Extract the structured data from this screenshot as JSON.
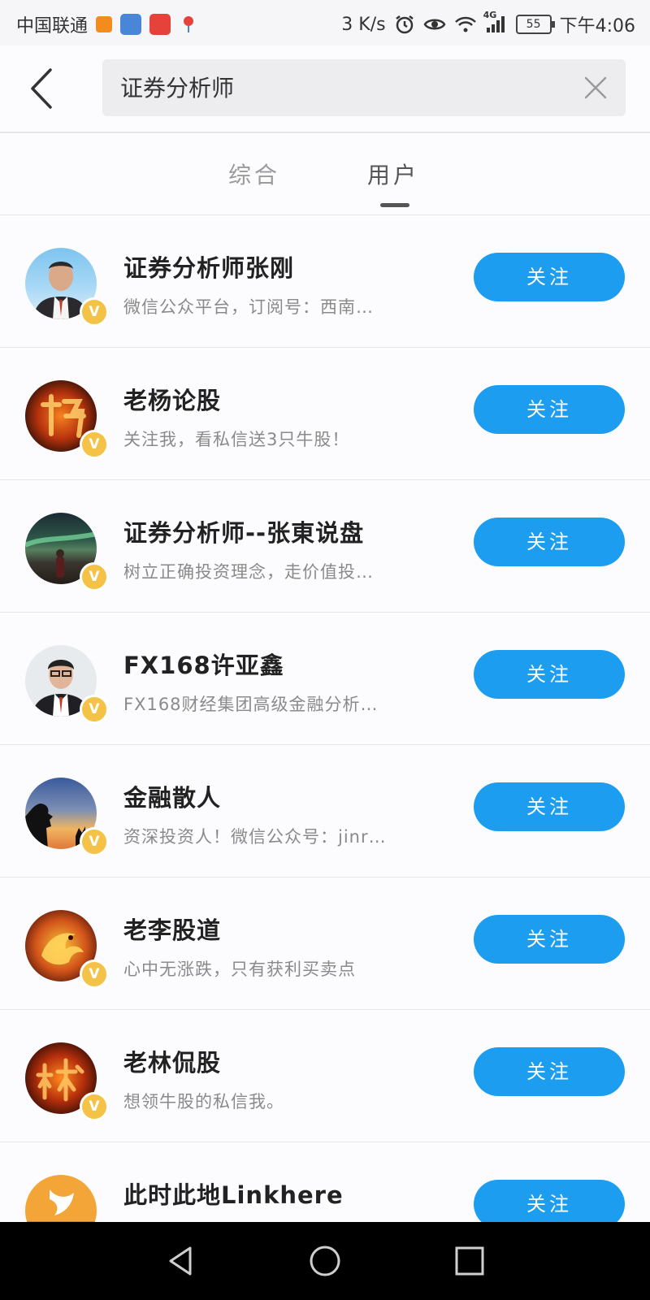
{
  "status_bar": {
    "carrier": "中国联通",
    "speed": "3 K/s",
    "battery": "55",
    "time": "下午4:06",
    "network": "4G"
  },
  "search": {
    "value": "证券分析师",
    "placeholder": ""
  },
  "tabs": [
    {
      "label": "综合",
      "active": false
    },
    {
      "label": "用户",
      "active": true
    }
  ],
  "users": [
    {
      "name": "证券分析师张刚",
      "desc": "微信公众平台，订阅号：西南…",
      "follow_label": "关注",
      "avatar_icon": "avatar-photo-man-suit"
    },
    {
      "name": "老杨论股",
      "desc": "关注我，看私信送3只牛股！",
      "follow_label": "关注",
      "avatar_icon": "avatar-fire-character"
    },
    {
      "name": "证券分析师--张東说盘",
      "desc": "树立正确投资理念，走价值投…",
      "follow_label": "关注",
      "avatar_icon": "avatar-aurora-landscape"
    },
    {
      "name": "FX168许亚鑫",
      "desc": "FX168财经集团高级金融分析…",
      "follow_label": "关注",
      "avatar_icon": "avatar-photo-man-glasses"
    },
    {
      "name": "金融散人",
      "desc": "资深投资人！微信公众号：jinr…",
      "follow_label": "关注",
      "avatar_icon": "avatar-silhouette-sunset"
    },
    {
      "name": "老李股道",
      "desc": "心中无涨跌，只有获利买卖点",
      "follow_label": "关注",
      "avatar_icon": "avatar-golden-dragon"
    },
    {
      "name": "老林侃股",
      "desc": "想领牛股的私信我。",
      "follow_label": "关注",
      "avatar_icon": "avatar-fire-character"
    },
    {
      "name": "此时此地Linkhere",
      "desc": "",
      "follow_label": "关注",
      "avatar_icon": "avatar-linkhere-logo"
    }
  ],
  "colors": {
    "accent": "#1c9df0",
    "verified": "#f3c246"
  }
}
